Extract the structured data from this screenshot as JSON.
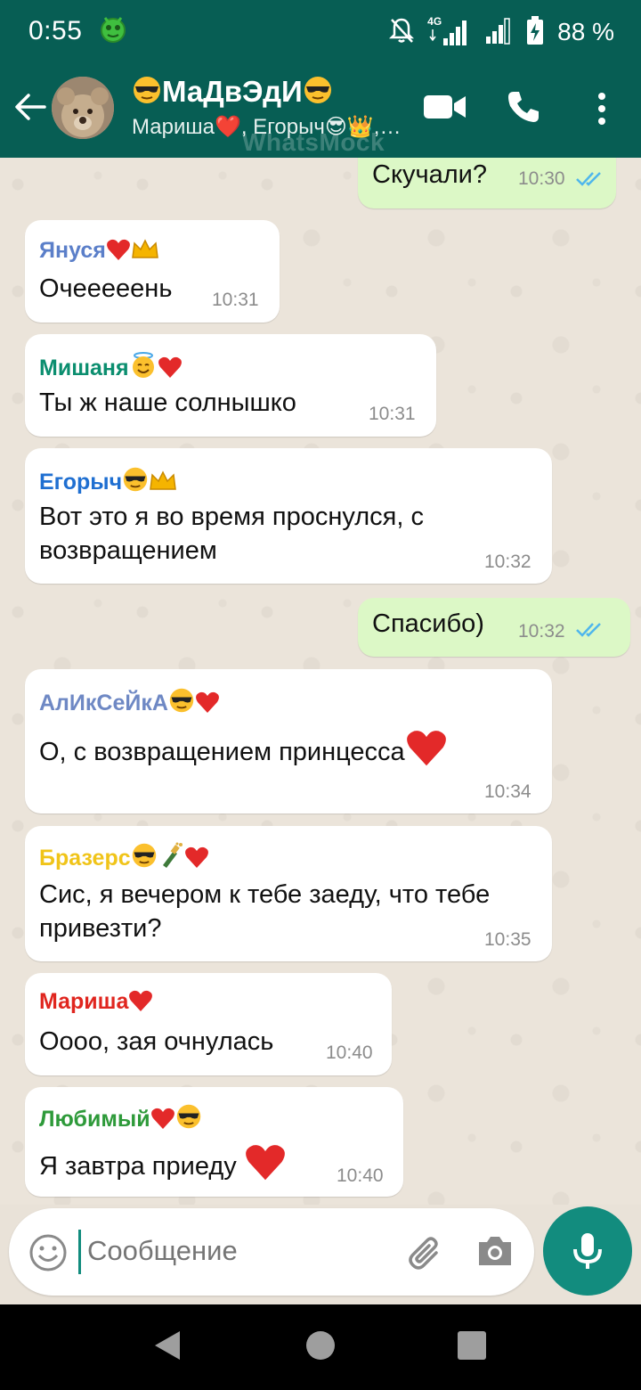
{
  "status_bar": {
    "time": "0:55",
    "network": "4G",
    "battery_text": "88 %"
  },
  "header": {
    "title_text": "МаДвЭдИ",
    "subtitle": "Мариша❤️, Егорыч😎👑,…",
    "watermark": "WhatsMock",
    "icons": [
      "back-arrow-icon",
      "video-call-icon",
      "phone-icon",
      "more-vert-icon"
    ]
  },
  "messages": [
    {
      "dir": "out",
      "text": "Скучали?",
      "time": "10:30",
      "read": true
    },
    {
      "dir": "in",
      "sender": "Януся",
      "sender_color": "#5b7fc9",
      "text": "Очееееень",
      "time": "10:31"
    },
    {
      "dir": "in",
      "sender": "Мишаня",
      "sender_color": "#0b8e6f",
      "text": "Ты ж наше солнышко",
      "time": "10:31"
    },
    {
      "dir": "in",
      "sender": "Егорыч",
      "sender_color": "#1f6fd1",
      "lines": [
        "Вот это я во время проснулся, с",
        "возвращением"
      ],
      "time": "10:32"
    },
    {
      "dir": "out",
      "text": "Спасибо)",
      "time": "10:32",
      "read": true
    },
    {
      "dir": "in",
      "sender": "АлИкСеЙкА",
      "sender_color": "#6e88c4",
      "text": "О, с возвращением принцесса",
      "time": "10:34"
    },
    {
      "dir": "in",
      "sender": "Бразерс",
      "sender_color": "#f0c419",
      "lines": [
        "Сис, я вечером к тебе заеду, что тебе",
        "привезти?"
      ],
      "time": "10:35"
    },
    {
      "dir": "in",
      "sender": "Мариша",
      "sender_color": "#e0261f",
      "text": "Оооо, зая очнулась",
      "time": "10:40"
    },
    {
      "dir": "in",
      "sender": "Любимый",
      "sender_color": "#2e9a3a",
      "text": "Я завтра приеду",
      "time": "10:40"
    }
  ],
  "composer": {
    "placeholder": "Сообщение",
    "icons": [
      "emoji-icon",
      "attach-icon",
      "camera-icon",
      "mic-icon"
    ]
  },
  "colors": {
    "header_bg": "#075e54",
    "accent": "#128c7e",
    "incoming_bubble": "#ffffff",
    "outgoing_bubble": "#dcf8c6",
    "read_tick": "#4fb6ec"
  }
}
